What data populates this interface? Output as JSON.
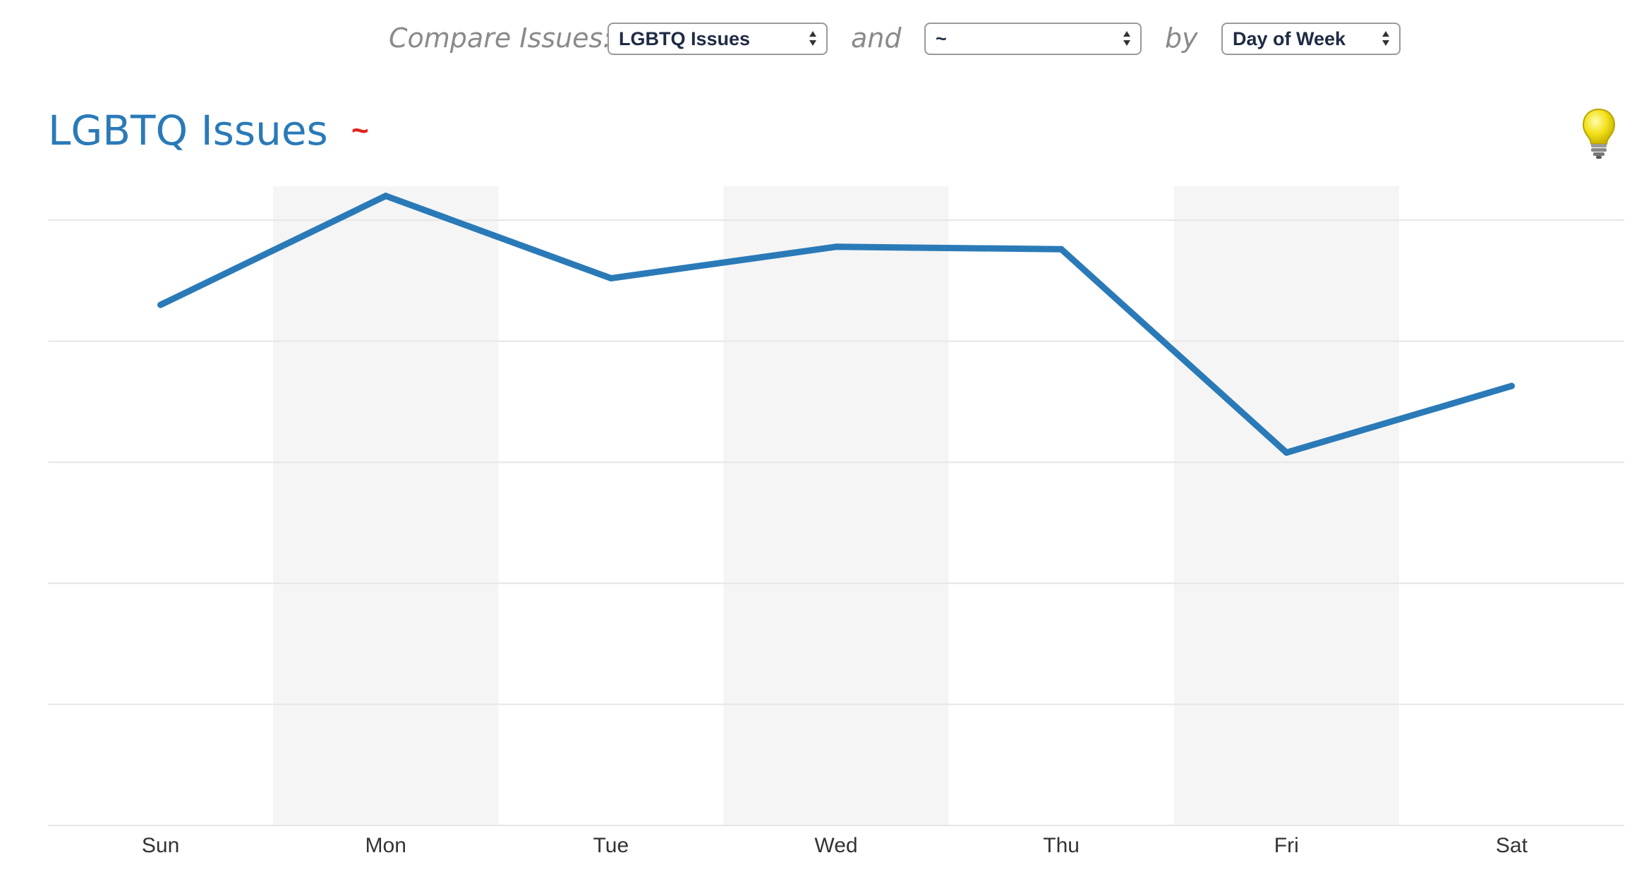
{
  "controls": {
    "compare_label": "Compare Issues:",
    "issue_a": "LGBTQ Issues",
    "and_label": "and",
    "issue_b": "~",
    "by_label": "by",
    "group_by": "Day of Week"
  },
  "header": {
    "title": "LGBTQ Issues",
    "separator": "~"
  },
  "colors": {
    "series": "#2a7ab8",
    "title": "#2a7ab8",
    "separator": "#e0211c",
    "band": "#f5f5f5",
    "grid": "#e6e6e6"
  },
  "chart_data": {
    "type": "line",
    "categories": [
      "Sun",
      "Mon",
      "Tue",
      "Wed",
      "Thu",
      "Fri",
      "Sat"
    ],
    "series": [
      {
        "values": [
          4.3,
          5.2,
          4.52,
          4.78,
          4.76,
          3.08,
          3.63
        ]
      }
    ],
    "ylim": [
      0,
      5
    ],
    "grid": true,
    "alternate_bands": true,
    "y_tick_labels_shown": false
  }
}
